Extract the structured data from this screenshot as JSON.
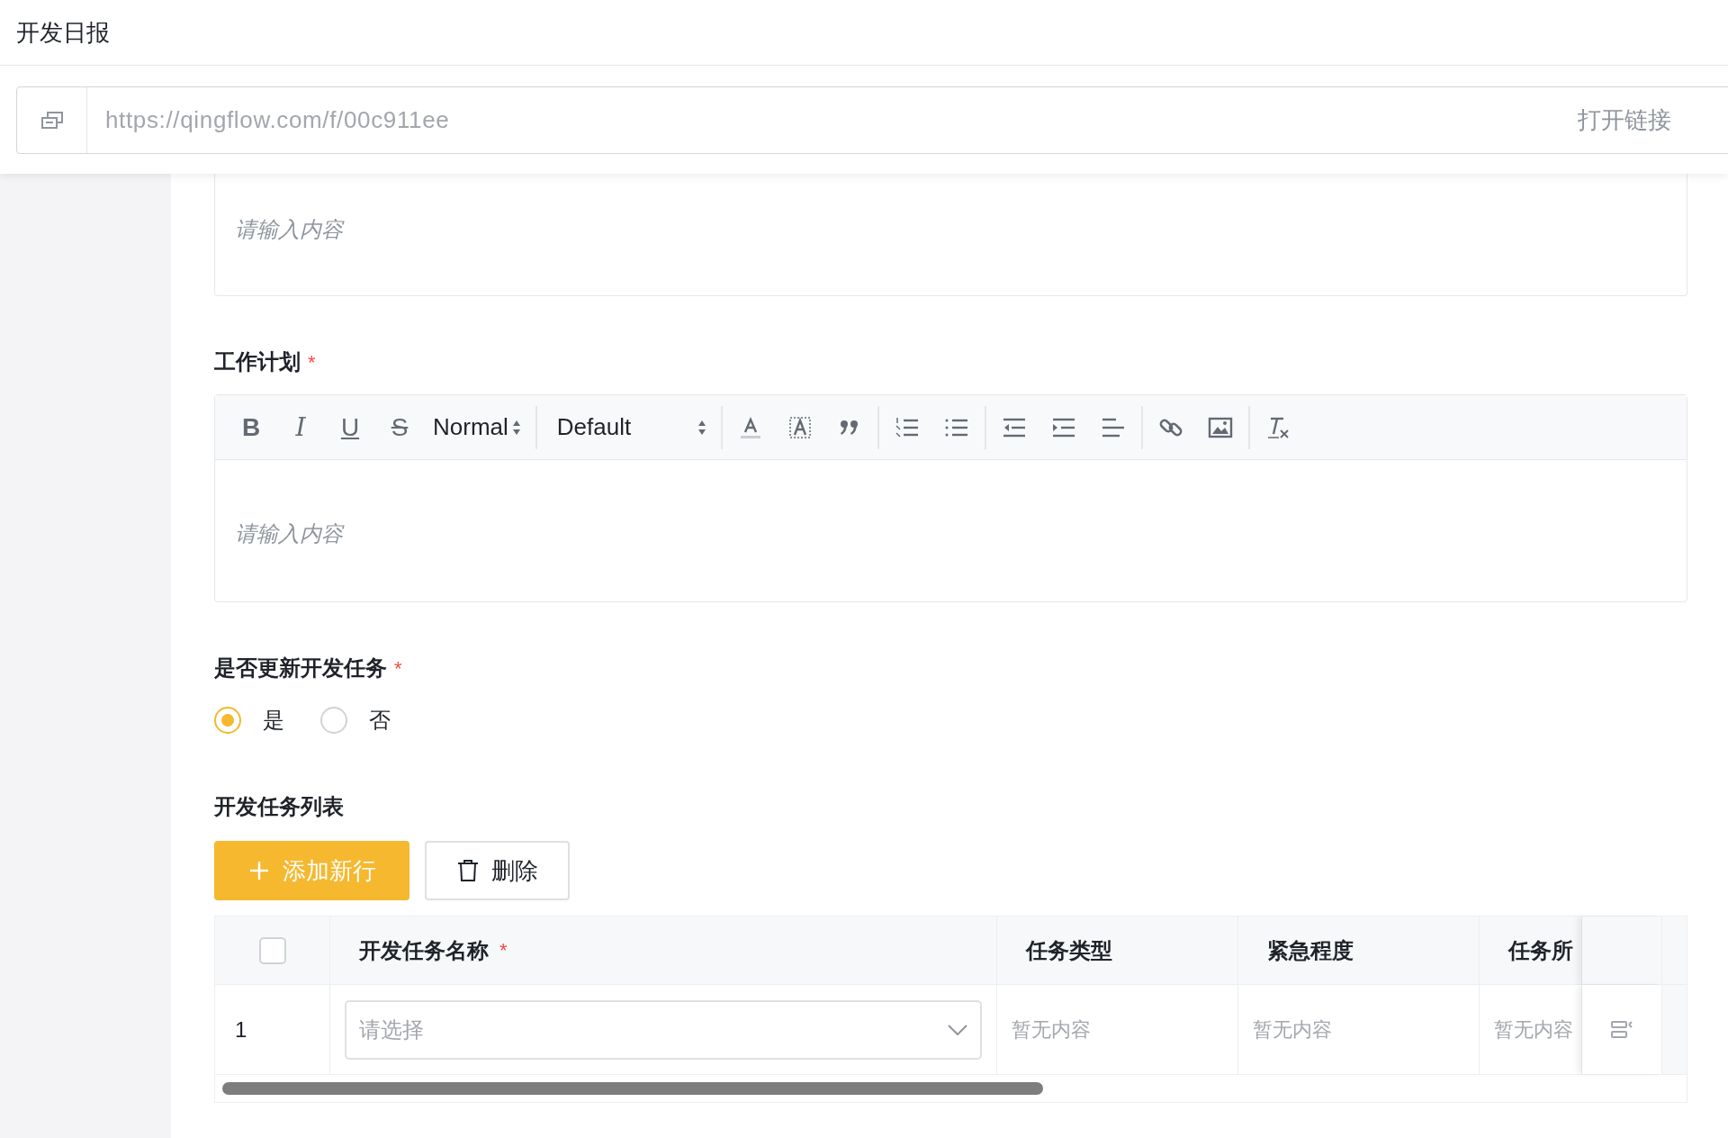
{
  "title": "开发日报",
  "link_bar": {
    "url": "https://qingflow.com/f/00c911ee",
    "open_link": "打开链接"
  },
  "fields": [
    {
      "kind": "richtext_partial",
      "placeholder": "请输入内容"
    },
    {
      "kind": "richtext",
      "label": "工作计划",
      "required_mark": "*",
      "format_buttons": [
        "B",
        "I",
        "U",
        "S"
      ],
      "size": "Normal",
      "font": "Default",
      "placeholder": "请输入内容"
    },
    {
      "kind": "radio",
      "label": "是否更新开发任务",
      "required_mark": "*",
      "options": [
        {
          "label": "是",
          "selected": true
        },
        {
          "label": "否",
          "selected": false
        }
      ]
    },
    {
      "kind": "subtable",
      "label": "开发任务列表",
      "add_button": "添加新行",
      "delete_button": "删除",
      "select_all": {
        "checked": false
      },
      "columns": [
        {
          "label": "开发任务名称",
          "required_mark": "*"
        },
        {
          "label": "任务类型"
        },
        {
          "label": "紧急程度"
        },
        {
          "label": "任务所"
        }
      ],
      "rows": [
        {
          "index": "1",
          "cells": [
            {
              "kind": "select",
              "placeholder": "请选择"
            },
            {
              "kind": "text",
              "value": "暂无内容"
            },
            {
              "kind": "text",
              "value": "暂无内容"
            },
            {
              "kind": "text",
              "value": "暂无内容"
            }
          ]
        }
      ]
    }
  ]
}
